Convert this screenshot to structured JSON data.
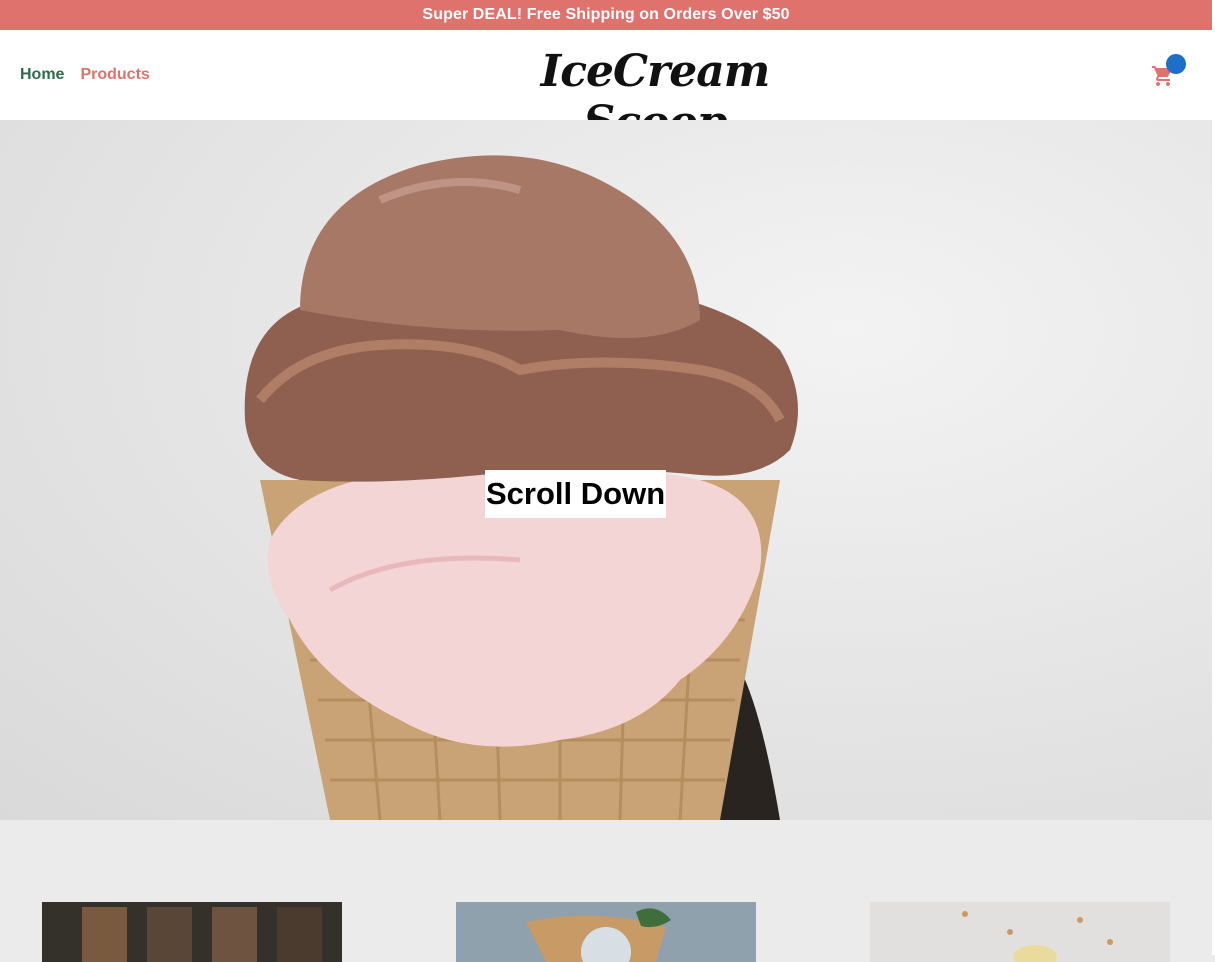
{
  "promo": {
    "text": "Super DEAL! Free Shipping on Orders Over $50"
  },
  "nav": {
    "home_label": "Home",
    "products_label": "Products"
  },
  "brand": {
    "logo_text": "IceCream Scoop"
  },
  "cart": {
    "icon": "cart-icon"
  },
  "hero": {
    "cta_label": "Scroll Down",
    "image": "ice-cream-cone-photo"
  },
  "products": [
    {
      "image": "storefront-photo"
    },
    {
      "image": "waffle-cone-photo"
    },
    {
      "image": "nuts-dessert-photo"
    }
  ],
  "colors": {
    "promo_bg": "#e0726d",
    "home_link": "#2f6b4f",
    "products_link": "#e0726d",
    "cart_badge": "#1e6fc9",
    "section_bg": "#ebebeb"
  }
}
